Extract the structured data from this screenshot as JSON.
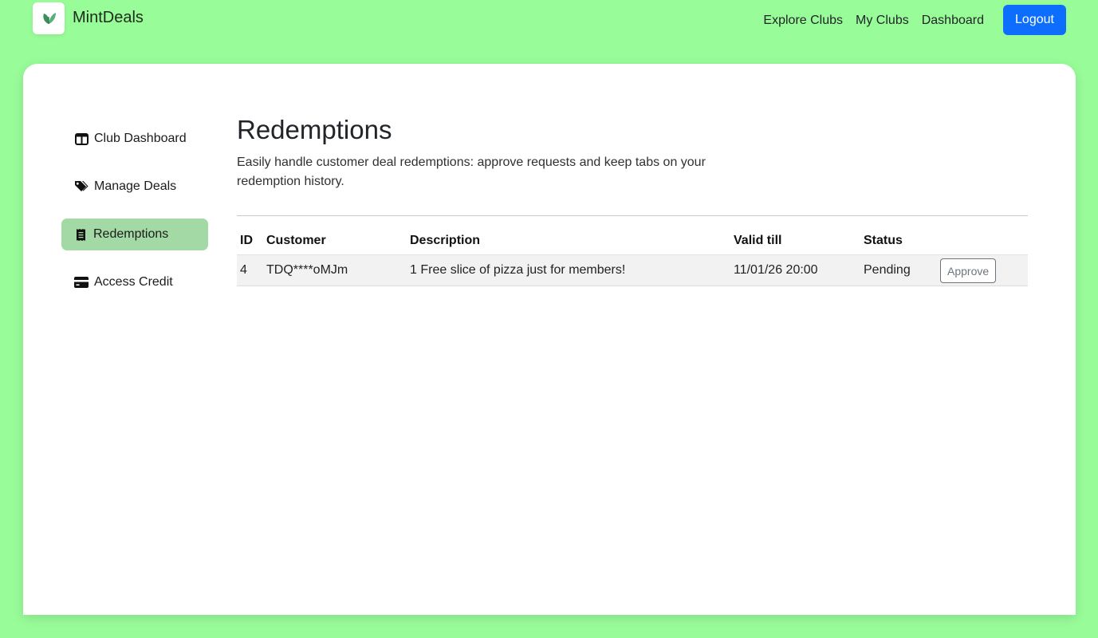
{
  "brand": {
    "name": "MintDeals",
    "logo_icon": "leaf-icon"
  },
  "nav": {
    "links": [
      "Explore Clubs",
      "My Clubs",
      "Dashboard"
    ],
    "logout_label": "Logout"
  },
  "colors": {
    "page_background": "#98fc98",
    "primary": "#0d6efd",
    "active_sidebar": "#a3d9a5",
    "leaf_green": "#3d8f5a"
  },
  "sidebar": {
    "items": [
      {
        "label": "Club Dashboard",
        "icon": "layout-icon"
      },
      {
        "label": "Manage Deals",
        "icon": "tags-icon"
      },
      {
        "label": "Redemptions",
        "icon": "receipt-icon",
        "active": true
      },
      {
        "label": "Access Credit",
        "icon": "credit-card-icon"
      }
    ]
  },
  "main": {
    "title": "Redemptions",
    "description": "Easily handle customer deal redemptions: approve requests and keep tabs on your redemption history.",
    "table": {
      "headers": [
        "ID",
        "Customer",
        "Description",
        "Valid till",
        "Status"
      ],
      "rows": [
        {
          "id": "4",
          "customer": "TDQ****oMJm",
          "description": "1 Free slice of pizza just for members!",
          "valid_till": "11/01/26 20:00",
          "status": "Pending",
          "action_label": "Approve"
        }
      ]
    }
  }
}
